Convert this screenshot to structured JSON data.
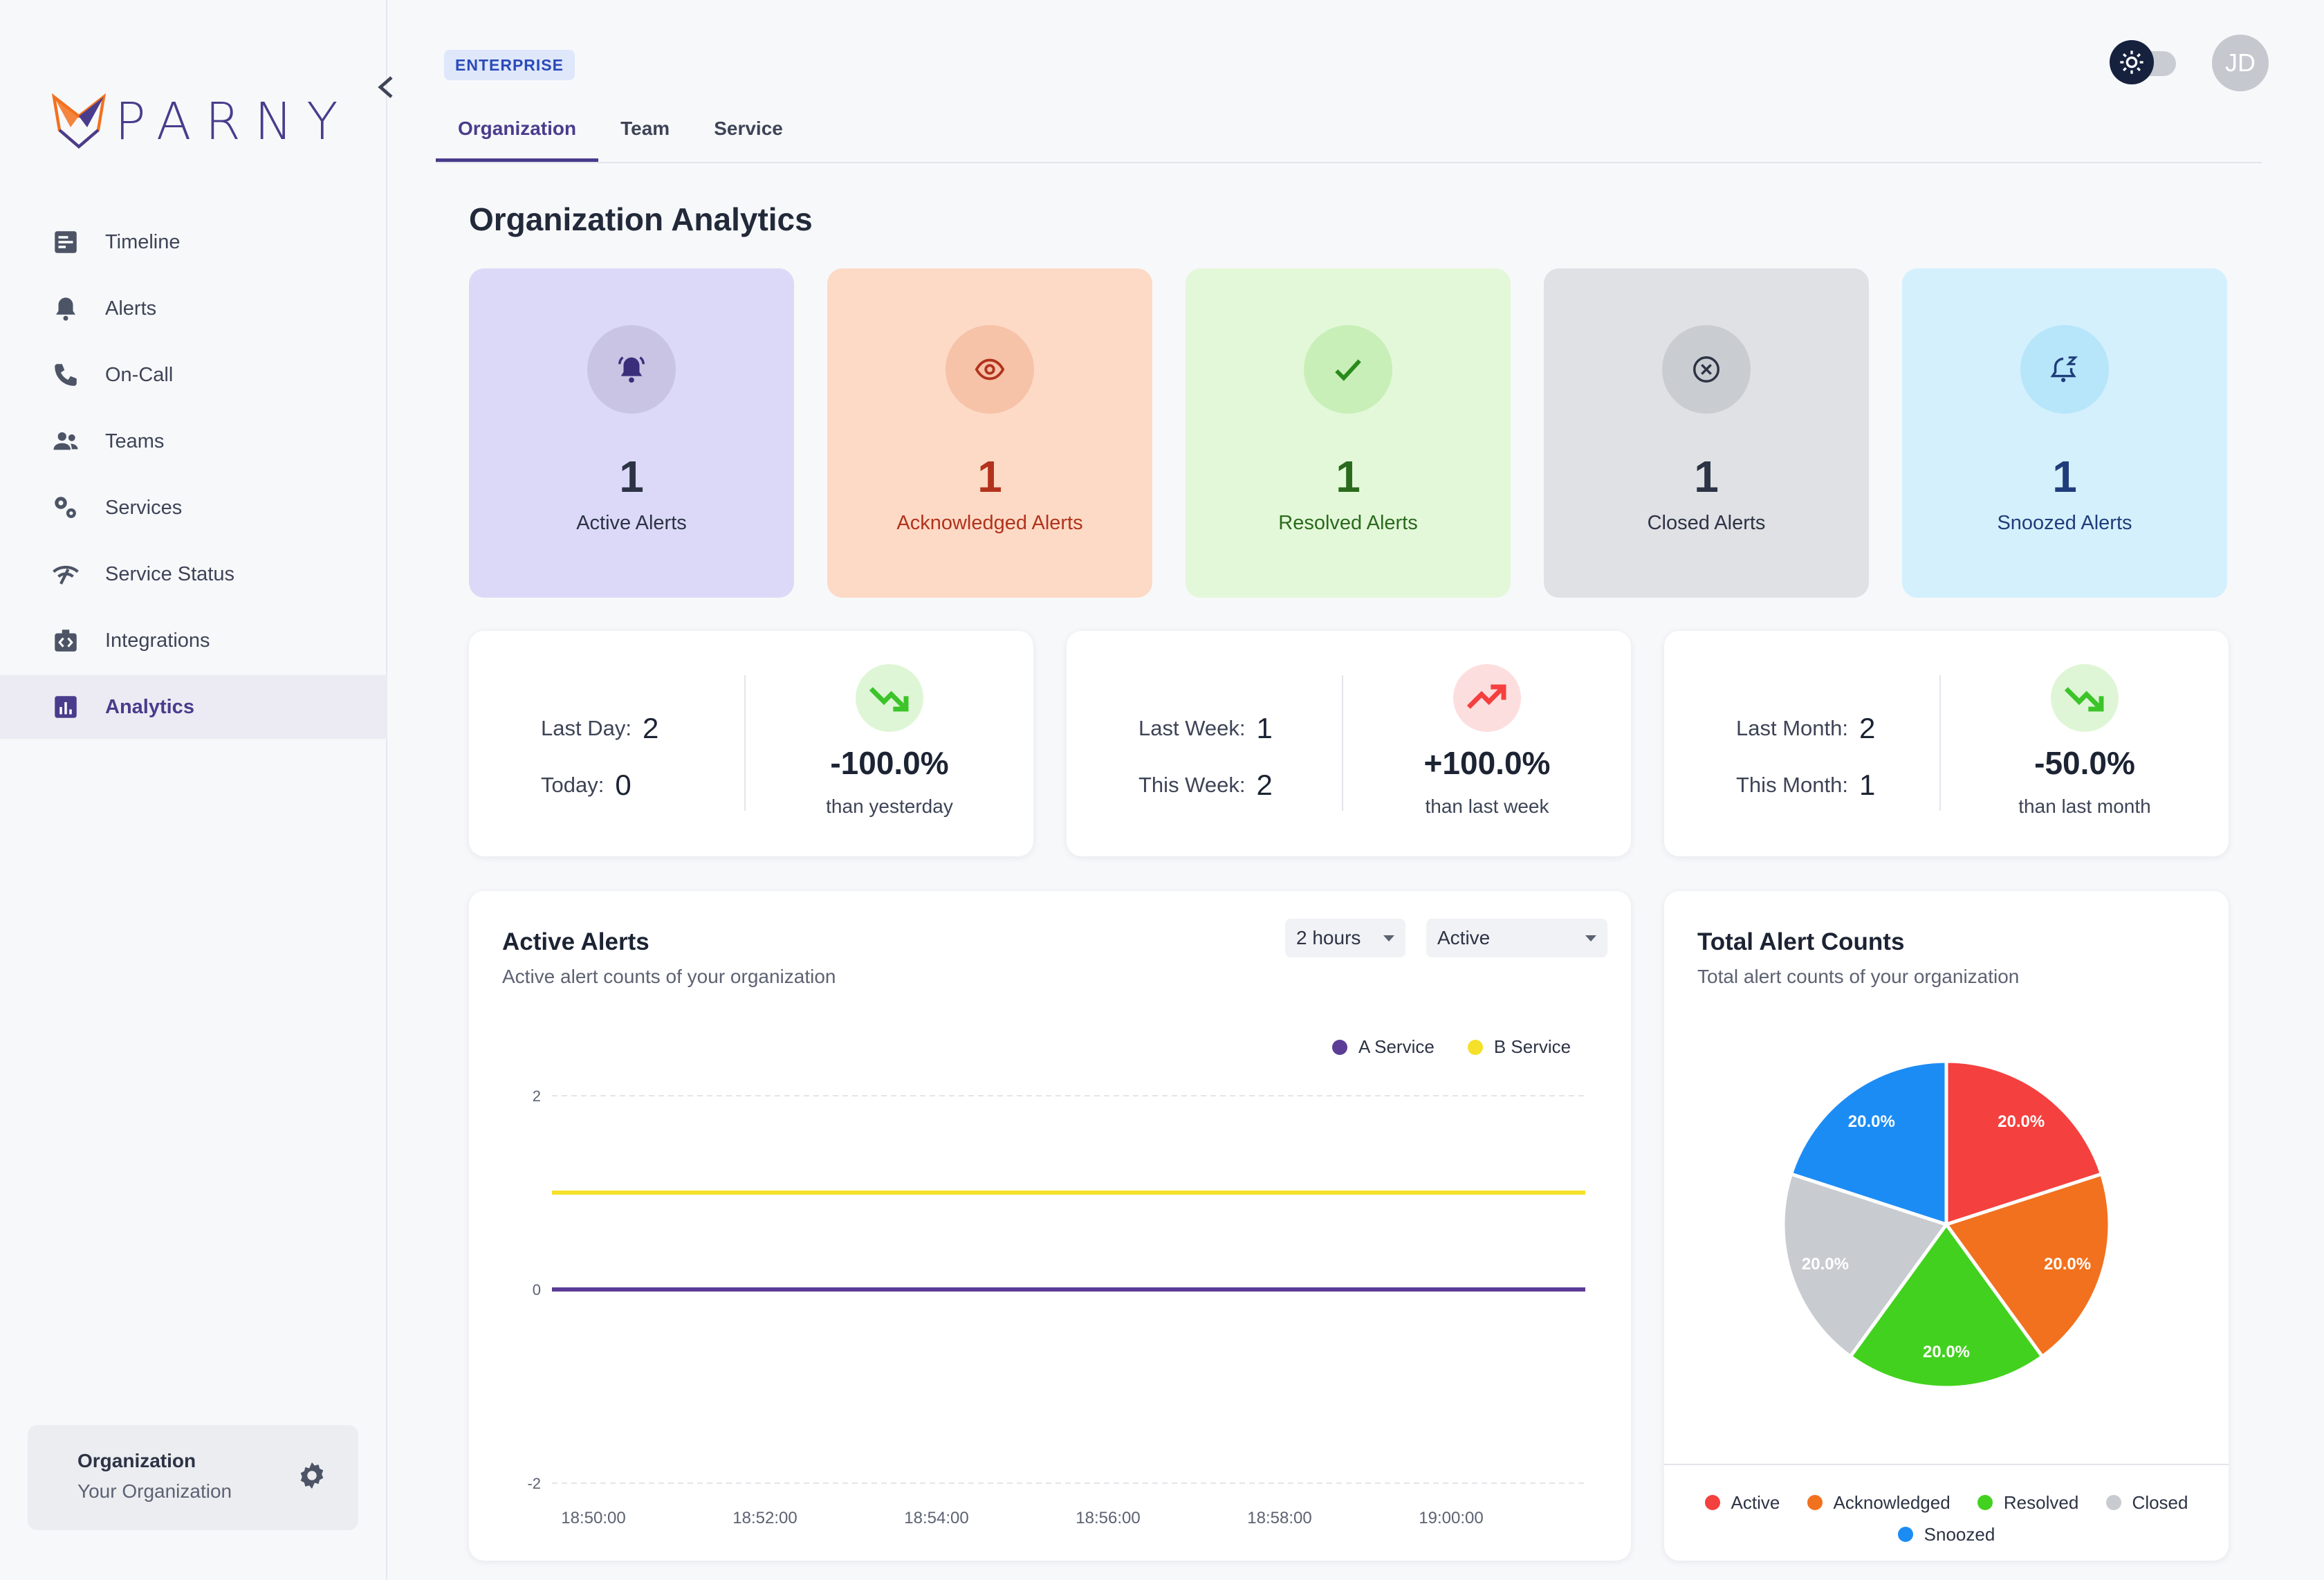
{
  "app": {
    "logo_text": "PARNY"
  },
  "sidebar": {
    "items": [
      {
        "label": "Timeline",
        "icon": "timeline-icon"
      },
      {
        "label": "Alerts",
        "icon": "bell-icon"
      },
      {
        "label": "On-Call",
        "icon": "phone-icon"
      },
      {
        "label": "Teams",
        "icon": "teams-icon"
      },
      {
        "label": "Services",
        "icon": "services-gear-icon"
      },
      {
        "label": "Service Status",
        "icon": "signal-icon"
      },
      {
        "label": "Integrations",
        "icon": "integrations-icon"
      },
      {
        "label": "Analytics",
        "icon": "analytics-icon",
        "active": true
      }
    ],
    "org_card": {
      "title": "Organization",
      "subtitle": "Your Organization"
    }
  },
  "header": {
    "plan_badge": "ENTERPRISE",
    "tabs": [
      {
        "label": "Organization",
        "active": true
      },
      {
        "label": "Team"
      },
      {
        "label": "Service"
      }
    ],
    "avatar_initials": "JD"
  },
  "page": {
    "title": "Organization Analytics"
  },
  "stats": [
    {
      "value": "1",
      "label": "Active Alerts",
      "bg": "#dcd9f8",
      "fg": "#2c3344",
      "icon": "bell-ringing-icon"
    },
    {
      "value": "1",
      "label": "Acknowledged Alerts",
      "bg": "#fddac6",
      "fg": "#b2321c",
      "icon": "eye-icon"
    },
    {
      "value": "1",
      "label": "Resolved Alerts",
      "bg": "#e3f8d9",
      "fg": "#2a6a1c",
      "icon": "check-icon"
    },
    {
      "value": "1",
      "label": "Closed Alerts",
      "bg": "#dfe1e4",
      "fg": "#2c3344",
      "icon": "x-circle-icon"
    },
    {
      "value": "1",
      "label": "Snoozed Alerts",
      "bg": "#d4f0fd",
      "fg": "#1f3d7a",
      "icon": "snooze-bell-icon"
    }
  ],
  "trends": [
    {
      "prev_label": "Last Day:",
      "prev_value": "2",
      "curr_label": "Today:",
      "curr_value": "0",
      "pct": "-100.0%",
      "sub": "than yesterday",
      "direction": "down"
    },
    {
      "prev_label": "Last Week:",
      "prev_value": "1",
      "curr_label": "This Week:",
      "curr_value": "2",
      "pct": "+100.0%",
      "sub": "than last week",
      "direction": "up"
    },
    {
      "prev_label": "Last Month:",
      "prev_value": "2",
      "curr_label": "This Month:",
      "curr_value": "1",
      "pct": "-50.0%",
      "sub": "than last month",
      "direction": "down"
    }
  ],
  "active_chart": {
    "title": "Active Alerts",
    "subtitle": "Active alert counts of your organization",
    "range_select": "2 hours",
    "status_select": "Active"
  },
  "pie_chart": {
    "title": "Total Alert Counts",
    "subtitle": "Total alert counts of your organization"
  },
  "chart_data": [
    {
      "type": "line",
      "x": [
        "18:50:00",
        "18:52:00",
        "18:54:00",
        "18:56:00",
        "18:58:00",
        "19:00:00"
      ],
      "ylim": [
        -2,
        2
      ],
      "yticks": [
        "2",
        "0",
        "-2"
      ],
      "grid": true,
      "legend": "top-right",
      "series": [
        {
          "name": "A Service",
          "color": "#5b3c96",
          "values": [
            0,
            0,
            0,
            0,
            0,
            0
          ]
        },
        {
          "name": "B Service",
          "color": "#f5e02a",
          "values": [
            1,
            1,
            1,
            1,
            1,
            1
          ]
        }
      ]
    },
    {
      "type": "pie",
      "legend": "bottom",
      "slices": [
        {
          "name": "Active",
          "value": 20.0,
          "label": "20.0%",
          "color": "#f4403f"
        },
        {
          "name": "Acknowledged",
          "value": 20.0,
          "label": "20.0%",
          "color": "#f2711e"
        },
        {
          "name": "Resolved",
          "value": 20.0,
          "label": "20.0%",
          "color": "#43d11f"
        },
        {
          "name": "Closed",
          "value": 20.0,
          "label": "20.0%",
          "color": "#c8cbd0"
        },
        {
          "name": "Snoozed",
          "value": 20.0,
          "label": "20.0%",
          "color": "#1c8cf5"
        }
      ]
    }
  ]
}
